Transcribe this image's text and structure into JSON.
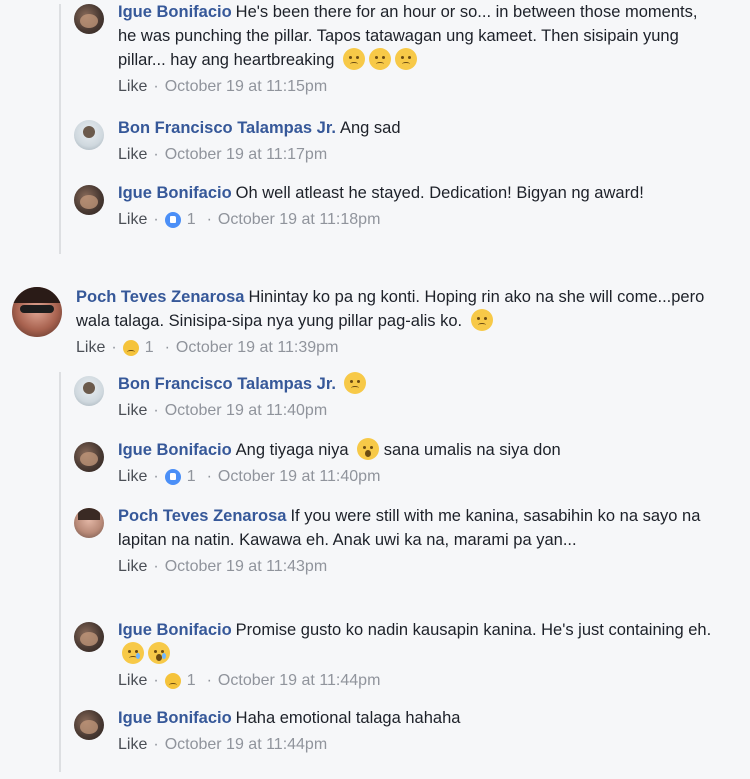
{
  "comments": [
    {
      "author": "Igue Bonifacio",
      "text": "He's been there for an hour or so... in between those moments, he was punching the pillar. Tapos tatawagan ung kameet. Then sisipain yung pillar... hay ang heartbreaking",
      "emojis": [
        "pensive-face",
        "pensive-face",
        "pensive-face"
      ],
      "like": "Like",
      "time": "October 19 at 11:15pm"
    },
    {
      "author": "Bon Francisco Talampas Jr.",
      "text": "Ang sad",
      "like": "Like",
      "time": "October 19 at 11:17pm"
    },
    {
      "author": "Igue Bonifacio",
      "text": "Oh well atleast he stayed. Dedication! Bigyan ng award!",
      "like": "Like",
      "reaction": {
        "type": "like",
        "count": "1"
      },
      "time": "October 19 at 11:18pm"
    },
    {
      "author": "Poch Teves Zenarosa",
      "text": "Hinintay ko pa ng konti. Hoping rin ako na she will come...pero wala talaga. Sinisipa-sipa nya yung pillar pag-alis ko.",
      "emojis": [
        "disappointed-face"
      ],
      "like": "Like",
      "reaction": {
        "type": "sad",
        "count": "1"
      },
      "time": "October 19 at 11:39pm"
    },
    {
      "author": "Bon Francisco Talampas Jr.",
      "text": "",
      "emojis": [
        "pensive-face"
      ],
      "like": "Like",
      "time": "October 19 at 11:40pm"
    },
    {
      "author": "Igue Bonifacio",
      "text": "Ang tiyaga niya",
      "text_after": "sana umalis na siya don",
      "emojis": [
        "surprised-face"
      ],
      "like": "Like",
      "reaction": {
        "type": "like",
        "count": "1"
      },
      "time": "October 19 at 11:40pm"
    },
    {
      "author": "Poch Teves Zenarosa",
      "text": "If you were still with me kanina, sasabihin ko na sayo na lapitan na natin. Kawawa eh. Anak uwi ka na, marami pa yan...",
      "like": "Like",
      "time": "October 19 at 11:43pm"
    },
    {
      "author": "Igue Bonifacio",
      "text": "Promise gusto ko nadin kausapin kanina. He's just containing eh.",
      "emojis": [
        "crying-face",
        "loudly-crying-face"
      ],
      "like": "Like",
      "reaction": {
        "type": "sad",
        "count": "1"
      },
      "time": "October 19 at 11:44pm"
    },
    {
      "author": "Igue Bonifacio",
      "text": "Haha emotional talaga hahaha",
      "like": "Like",
      "time": "October 19 at 11:44pm"
    }
  ]
}
